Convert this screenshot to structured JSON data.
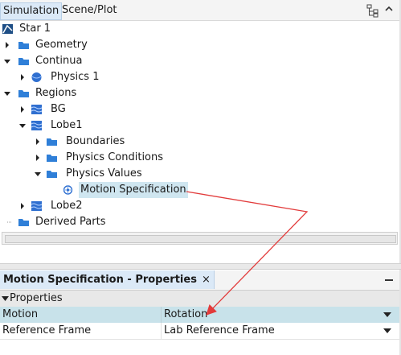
{
  "tabs": {
    "simulation": "Simulation",
    "scene_plot": "Scene/Plot"
  },
  "tree": {
    "root": "Star 1",
    "geometry": "Geometry",
    "continua": "Continua",
    "physics1": "Physics 1",
    "regions": "Regions",
    "bg": "BG",
    "lobe1": "Lobe1",
    "boundaries": "Boundaries",
    "physics_conditions": "Physics Conditions",
    "physics_values": "Physics Values",
    "motion_specification": "Motion Specification",
    "lobe2": "Lobe2",
    "derived_parts": "Derived Parts"
  },
  "properties": {
    "panel_title": "Motion Specification - Properties",
    "close": "×",
    "section": "Properties",
    "rows": [
      {
        "name": "Motion",
        "value": "Rotation"
      },
      {
        "name": "Reference Frame",
        "value": "Lab Reference Frame"
      }
    ]
  },
  "colors": {
    "folder": "#2f7fd8",
    "selection": "#cfe6f0",
    "annotation_arrow": "#e23b3b"
  }
}
